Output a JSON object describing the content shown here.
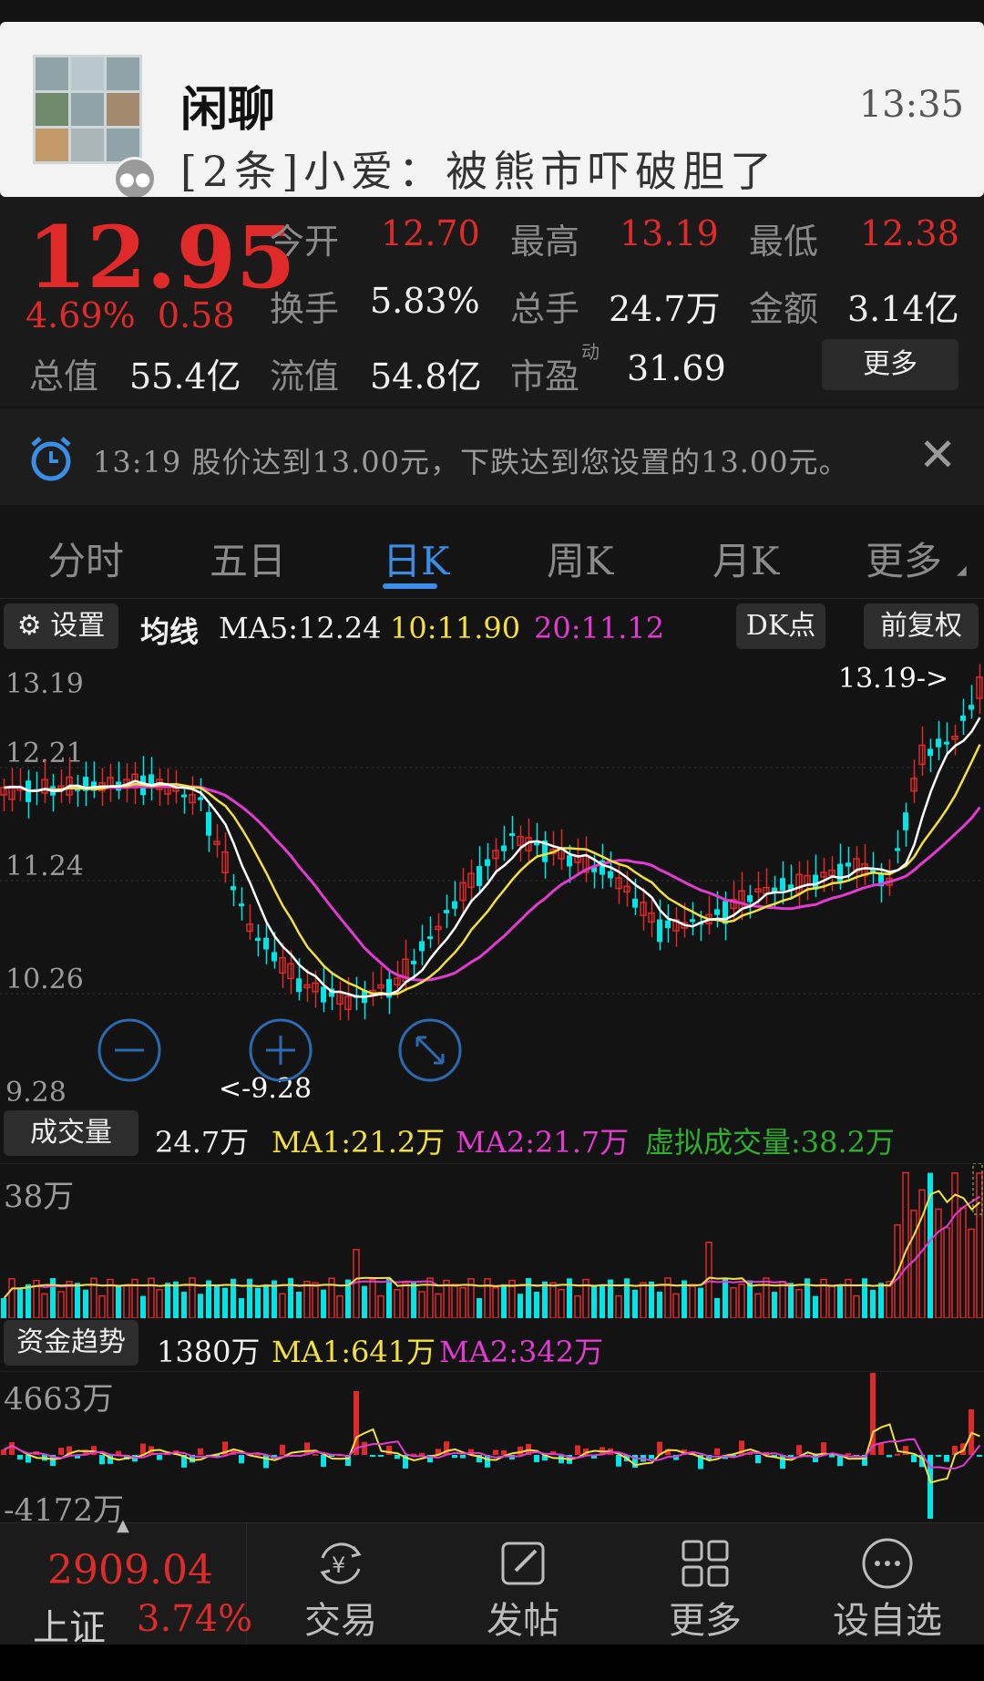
{
  "notification": {
    "title": "闲聊",
    "message": "[2条]小爱：被熊市吓破胆了",
    "time": "13:35"
  },
  "quote": {
    "price": "12.95",
    "change_pct": "4.69%",
    "change": "0.58",
    "rows": [
      [
        {
          "label": "今开",
          "value": "12.70",
          "color": "red"
        },
        {
          "label": "最高",
          "value": "13.19",
          "color": "red"
        },
        {
          "label": "最低",
          "value": "12.38",
          "color": "red"
        }
      ],
      [
        {
          "label": "换手",
          "value": "5.83%",
          "color": "white"
        },
        {
          "label": "总手",
          "value": "24.7万",
          "color": "white"
        },
        {
          "label": "金额",
          "value": "3.14亿",
          "color": "white"
        }
      ],
      [
        {
          "label": "总值",
          "value": "55.4亿",
          "color": "white"
        },
        {
          "label": "流值",
          "value": "54.8亿",
          "color": "white"
        },
        {
          "label": "市盈",
          "value": "31.69",
          "color": "white"
        }
      ]
    ],
    "pe_superscript": "动",
    "more_label": "更多"
  },
  "alert": {
    "text": "13:19 股价达到13.00元，下跌达到您设置的13.00元。",
    "icon": "alarm-clock-icon"
  },
  "tabs": [
    "分时",
    "五日",
    "日K",
    "周K",
    "月K",
    "更多"
  ],
  "active_tab": "日K",
  "ma_bar": {
    "settings_label": "设置",
    "title": "均线",
    "ma5": "MA5:12.24",
    "ma10": "10:11.90",
    "ma20": "20:11.12",
    "dk_label": "DK点",
    "adjust_label": "前复权"
  },
  "kline": {
    "y_labels": [
      "13.19",
      "12.21",
      "11.24",
      "10.26",
      "9.28"
    ],
    "high_marker": "13.19->",
    "low_marker": "<-9.28"
  },
  "volume_bar": {
    "label": "成交量",
    "value": "24.7万",
    "ma1": "MA1:21.2万",
    "ma2": "MA2:21.7万",
    "virtual": "虚拟成交量:38.2万",
    "y_top": "38万"
  },
  "fund_bar": {
    "label": "资金趋势",
    "value": "1380万",
    "ma1": "MA1:641万",
    "ma2": "MA2:342万",
    "y_top": "4663万",
    "y_bottom": "-4172万"
  },
  "bottom": {
    "index_value": "2909.04",
    "index_name": "上证",
    "index_pct": "3.74%",
    "items": [
      {
        "label": "交易",
        "icon": "yen-cycle-icon"
      },
      {
        "label": "发帖",
        "icon": "edit-icon"
      },
      {
        "label": "更多",
        "icon": "grid-icon"
      },
      {
        "label": "设自选",
        "icon": "more-dots-icon"
      }
    ]
  },
  "colors": {
    "up": "#e02a2a",
    "down": "#00e5e5",
    "ma5": "#ffffff",
    "ma10": "#f2e040",
    "ma20": "#e33ad2",
    "accent": "#3a8ee6"
  }
}
